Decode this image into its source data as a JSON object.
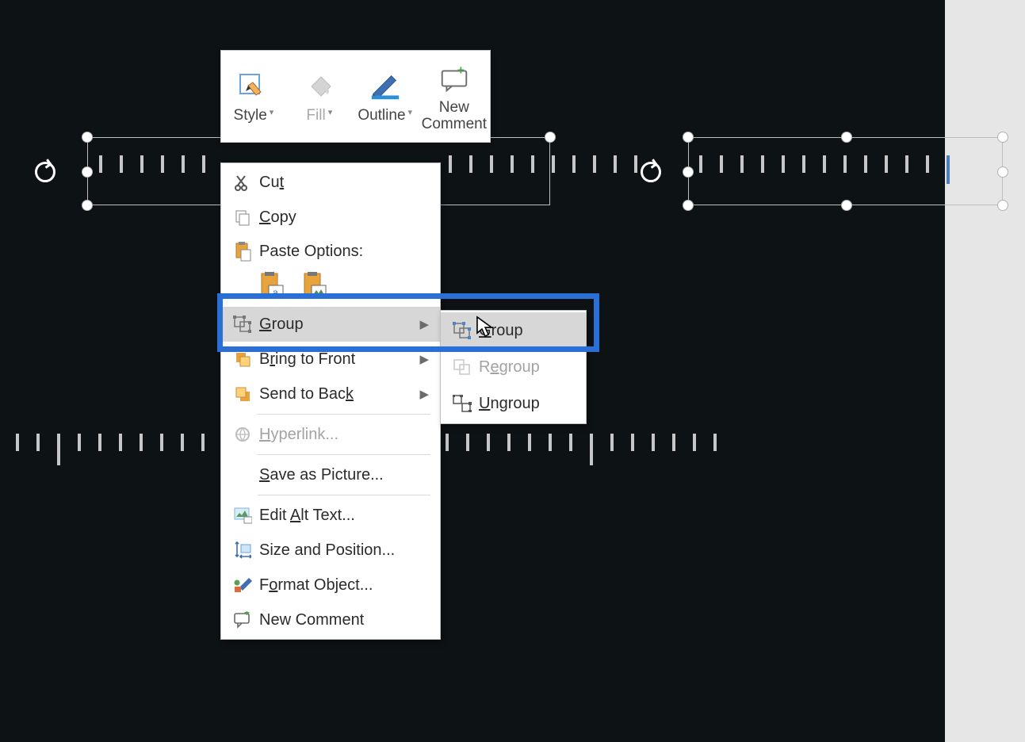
{
  "mini_toolbar": {
    "style": "Style",
    "fill": "Fill",
    "outline": "Outline",
    "new_comment": "New Comment"
  },
  "context_menu": {
    "cut": "Cut",
    "copy": "Copy",
    "paste_options": "Paste Options:",
    "group": "Group",
    "bring_to_front": "Bring to Front",
    "send_to_back": "Send to Back",
    "hyperlink": "Hyperlink...",
    "save_as_picture": "Save as Picture...",
    "edit_alt_text": "Edit Alt Text...",
    "size_and_position": "Size and Position...",
    "format_object": "Format Object...",
    "new_comment": "New Comment"
  },
  "submenu": {
    "group": "Group",
    "regroup": "Regroup",
    "ungroup": "Ungroup"
  }
}
